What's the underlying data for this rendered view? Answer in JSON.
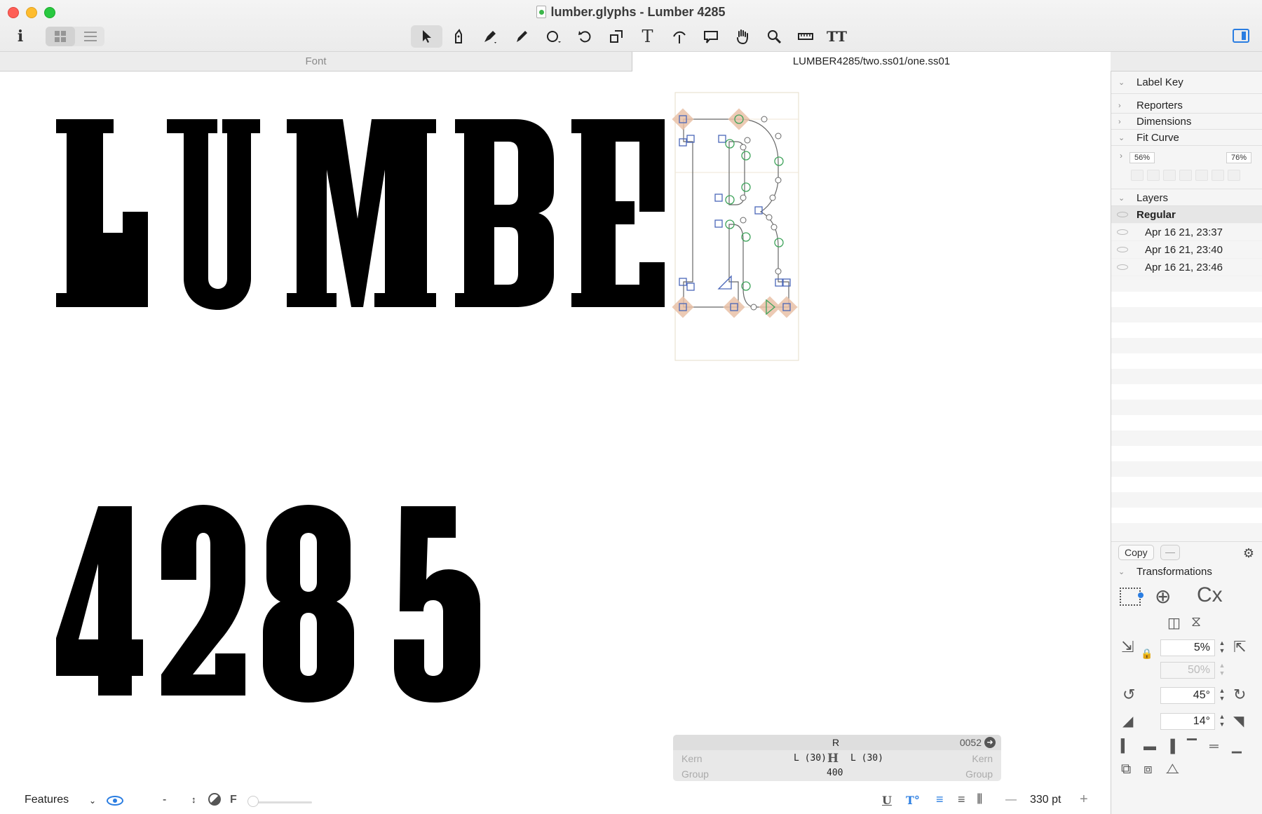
{
  "window": {
    "title": "lumber.glyphs - Lumber 4285",
    "sidebar_toggle_icon": "sidebar-right-icon"
  },
  "toolbar": {
    "info_label": "i",
    "view_modes": [
      "grid-view-icon",
      "list-view-icon"
    ],
    "tools": [
      {
        "name": "select-tool",
        "icon": "arrow-cursor-icon",
        "active": true
      },
      {
        "name": "select-all-layers-tool",
        "icon": "pen-nib-select-icon"
      },
      {
        "name": "draw-tool",
        "icon": "pen-icon"
      },
      {
        "name": "pencil-tool",
        "icon": "pencil-icon"
      },
      {
        "name": "primitives-tool",
        "icon": "circle-icon"
      },
      {
        "name": "rotate-tool",
        "icon": "rotate-icon"
      },
      {
        "name": "scale-tool",
        "icon": "scale-icon"
      },
      {
        "name": "text-tool",
        "icon": "text-icon",
        "label": "T"
      },
      {
        "name": "knife-tool",
        "icon": "knife-icon"
      },
      {
        "name": "annotation-tool",
        "icon": "speech-bubble-icon"
      },
      {
        "name": "hand-tool",
        "icon": "hand-icon"
      },
      {
        "name": "zoom-tool",
        "icon": "magnifier-icon"
      },
      {
        "name": "measurement-tool",
        "icon": "ruler-icon"
      },
      {
        "name": "font-info-tool",
        "icon": "text-size-icon",
        "label": "TT"
      }
    ]
  },
  "tabs": {
    "font": "Font",
    "glyph": "LUMBER4285/two.ss01/one.ss01"
  },
  "canvas": {
    "line1": "LUMBE",
    "line2": "4285",
    "active_glyph": "R"
  },
  "panel": {
    "label_key": "Label Key",
    "reporters": "Reporters",
    "dimensions": "Dimensions",
    "fit_curve": "Fit Curve",
    "fit_min": "56%",
    "fit_max": "76%",
    "layers_title": "Layers",
    "master": "Regular",
    "layers": [
      "Apr 16 21, 23:37",
      "Apr 16 21, 23:40",
      "Apr 16 21, 23:46"
    ],
    "copy": "Copy",
    "dash": "—",
    "transformations": "Transformations",
    "scale_value": "5%",
    "scale_value_2": "50%",
    "rotate_value": "45°",
    "slant_value": "14°",
    "cx_label": "Cx"
  },
  "glyph_info": {
    "glyph_name": "R",
    "unicode": "0052",
    "kern_left": "Kern",
    "kern_right": "Kern",
    "group_left": "Group",
    "group_right": "Group",
    "left_group": "L (30)",
    "right_group": "L (30)",
    "width": "400"
  },
  "bottombar": {
    "features": "Features",
    "dash": "-",
    "f_label": "F",
    "zoom": "330 pt",
    "minus": "—",
    "plus": "+"
  },
  "colors": {
    "accent": "#2a7de1",
    "node_square": "#4a66b8",
    "node_smooth": "#3ea35a",
    "node_extreme": "#e8b79a"
  }
}
